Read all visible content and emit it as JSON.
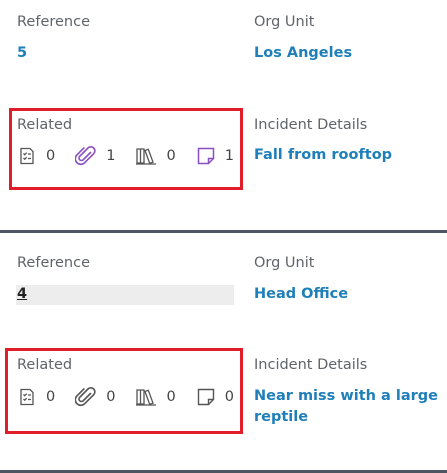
{
  "records": [
    {
      "reference_label": "Reference",
      "reference_value": "5",
      "org_unit_label": "Org Unit",
      "org_unit_value": "Los Angeles",
      "related_label": "Related",
      "related": [
        {
          "icon": "checklist-icon",
          "count": "0",
          "color": "#555555"
        },
        {
          "icon": "paperclip-icon",
          "count": "1",
          "color": "#8a4fc4"
        },
        {
          "icon": "library-books-icon",
          "count": "0",
          "color": "#555555"
        },
        {
          "icon": "sticky-note-icon",
          "count": "1",
          "color": "#8a4fc4"
        }
      ],
      "incident_label": "Incident Details",
      "incident_value": "Fall from rooftop"
    },
    {
      "reference_label": "Reference",
      "reference_value": "4",
      "org_unit_label": "Org Unit",
      "org_unit_value": "Head Office",
      "related_label": "Related",
      "related": [
        {
          "icon": "checklist-icon",
          "count": "0",
          "color": "#555555"
        },
        {
          "icon": "paperclip-icon",
          "count": "0",
          "color": "#555555"
        },
        {
          "icon": "library-books-icon",
          "count": "0",
          "color": "#555555"
        },
        {
          "icon": "sticky-note-icon",
          "count": "0",
          "color": "#555555"
        }
      ],
      "incident_label": "Incident Details",
      "incident_value": "Near miss with a large reptile"
    }
  ],
  "highlight_color": "#e11d2a",
  "link_color": "#1f7fb8"
}
